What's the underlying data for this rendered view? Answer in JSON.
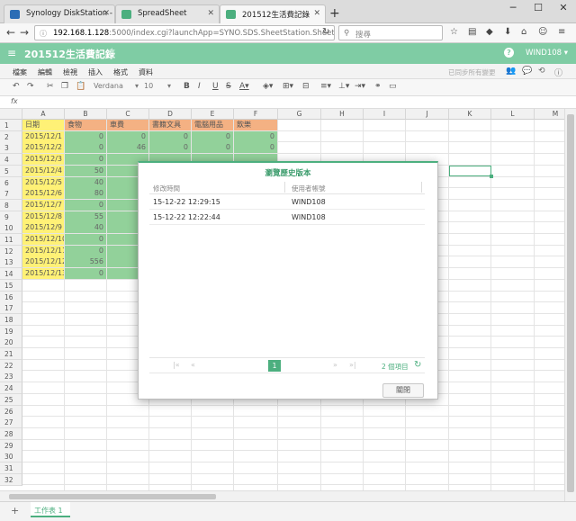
{
  "browser": {
    "tabs": [
      {
        "title": "Synology DiskStation - ...",
        "active": false,
        "favicon_color": "#2b6db5"
      },
      {
        "title": "SpreadSheet",
        "active": false,
        "favicon_color": "#4caf7f"
      },
      {
        "title": "201512生活費記錄",
        "active": true,
        "favicon_color": "#4caf7f"
      }
    ],
    "url_host": "192.168.1.128",
    "url_path": ":5000/index.cgi?launchApp=SYNO.SDS.SheetStation.Sheet.Appli",
    "search_placeholder": "搜尋"
  },
  "app": {
    "doc_title": "201512生活費記錄",
    "user": "WIND108 ▾",
    "help": "?",
    "accent": "#7fcca4"
  },
  "menu": {
    "items": [
      "檔案",
      "編輯",
      "檢視",
      "插入",
      "格式",
      "資料"
    ],
    "save_status": "已同步所有變更"
  },
  "toolbar": {
    "font": "Verdana",
    "size": "10"
  },
  "formula": {
    "label": "fx"
  },
  "grid": {
    "columns": [
      "A",
      "B",
      "C",
      "D",
      "E",
      "F",
      "G",
      "H",
      "I",
      "J",
      "K",
      "L",
      "M"
    ],
    "rows": [
      "1",
      "2",
      "3",
      "4",
      "5",
      "6",
      "7",
      "8",
      "9",
      "10",
      "11",
      "12",
      "13",
      "14",
      "15",
      "16",
      "17",
      "18",
      "19",
      "20",
      "21",
      "22",
      "23",
      "24",
      "25",
      "26",
      "27",
      "28",
      "29",
      "30",
      "31",
      "32"
    ],
    "header_row": [
      "日期",
      "食物",
      "車費",
      "書籍文具",
      "電腦用品",
      "飲樂"
    ],
    "dates": [
      "2015/12/1",
      "2015/12/2",
      "2015/12/3",
      "2015/12/4",
      "2015/12/5",
      "2015/12/6",
      "2015/12/7",
      "2015/12/8",
      "2015/12/9",
      "2015/12/10",
      "2015/12/11",
      "2015/12/12",
      "2015/12/13"
    ],
    "food": [
      "0",
      "0",
      "0",
      "50",
      "40",
      "80",
      "0",
      "55",
      "40",
      "0",
      "0",
      "556",
      "0"
    ],
    "row2_rest": [
      "0",
      "0",
      "0",
      "0"
    ],
    "row3_rest": [
      "46",
      "0",
      "0",
      "0"
    ],
    "colors": {
      "date": "#fff176",
      "header": "#f4b183",
      "value": "#92d19a"
    }
  },
  "sheet": {
    "tab_label": "工作表 1",
    "add": "+"
  },
  "dialog": {
    "title": "瀏覽歷史版本",
    "col_time": "修改時間",
    "col_user": "使用者帳號",
    "rows": [
      {
        "time": "15-12-22 12:29:15",
        "user": "WIND108"
      },
      {
        "time": "15-12-22 12:22:44",
        "user": "WIND108"
      }
    ],
    "page": "1",
    "count": "2 個項目",
    "close": "關閉"
  }
}
